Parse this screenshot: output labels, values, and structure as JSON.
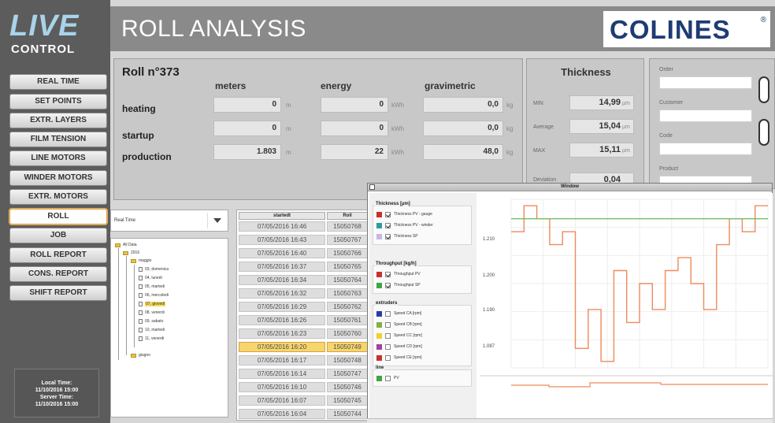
{
  "logo": {
    "live": "LIVE",
    "control": "CONTROL"
  },
  "header": {
    "title": "ROLL ANALYSIS",
    "brand": "COLINES",
    "brand_mark": "®"
  },
  "nav": {
    "items": [
      {
        "label": "REAL TIME"
      },
      {
        "label": "SET POINTS"
      },
      {
        "label": "EXTR. LAYERS"
      },
      {
        "label": "FILM TENSION"
      },
      {
        "label": "LINE MOTORS"
      },
      {
        "label": "WINDER MOTORS"
      },
      {
        "label": "EXTR. MOTORS"
      },
      {
        "label": "ROLL"
      },
      {
        "label": "JOB"
      },
      {
        "label": "ROLL REPORT"
      },
      {
        "label": "CONS. REPORT"
      },
      {
        "label": "SHIFT REPORT"
      }
    ],
    "active": "ROLL"
  },
  "clock": {
    "local_label": "Local Time:",
    "local_value": "11/10/2016 15:00",
    "server_label": "Server Time:",
    "server_value": "11/10/2016 15:00"
  },
  "roll": {
    "title": "Roll n°373",
    "columns": [
      "meters",
      "energy",
      "gravimetric"
    ],
    "rows": [
      {
        "label": "heating",
        "meters": "0",
        "meters_unit": "m",
        "energy": "0",
        "energy_unit": "kWh",
        "grav": "0,0",
        "grav_unit": "kg"
      },
      {
        "label": "startup",
        "meters": "0",
        "meters_unit": "m",
        "energy": "0",
        "energy_unit": "kWh",
        "grav": "0,0",
        "grav_unit": "kg"
      },
      {
        "label": "production",
        "meters": "1.803",
        "meters_unit": "m",
        "energy": "22",
        "energy_unit": "kWh",
        "grav": "48,0",
        "grav_unit": "kg"
      }
    ]
  },
  "thickness": {
    "title": "Thickness",
    "rows": [
      {
        "label": "MIN",
        "value": "14,99",
        "unit": "µm"
      },
      {
        "label": "Average",
        "value": "15,04",
        "unit": "µm"
      },
      {
        "label": "MAX",
        "value": "15,11",
        "unit": "µm"
      }
    ],
    "partial_label": "Deviation",
    "partial_value": "0,04"
  },
  "info": {
    "fields": [
      "Order",
      "Customer",
      "Code",
      "Product"
    ]
  },
  "filter": {
    "value": "Real Time"
  },
  "tree": {
    "root": "All Data",
    "year": "2016",
    "month": "maggio",
    "days": [
      "03, domenica",
      "04, lunedi",
      "05, martedi",
      "06, mercoledi",
      "07, giovedi",
      "08, venerdi",
      "09, sabato",
      "10, martedi",
      "11, venerdi"
    ],
    "selected": "07, giovedi",
    "sibling": "giugno"
  },
  "rolls_list": {
    "headers": [
      "startedt",
      "Roll"
    ],
    "rows": [
      {
        "date": "07/05/2016 16:46",
        "roll": "15050768"
      },
      {
        "date": "07/05/2016 16:43",
        "roll": "15050767"
      },
      {
        "date": "07/05/2016 16:40",
        "roll": "15050766"
      },
      {
        "date": "07/05/2016 16:37",
        "roll": "15050765"
      },
      {
        "date": "07/05/2016 16:34",
        "roll": "15050764"
      },
      {
        "date": "07/05/2016 16:32",
        "roll": "15050763"
      },
      {
        "date": "07/05/2016 16:29",
        "roll": "15050762"
      },
      {
        "date": "07/05/2016 16:26",
        "roll": "15050761"
      },
      {
        "date": "07/05/2016 16:23",
        "roll": "15050760"
      },
      {
        "date": "07/05/2016 16:20",
        "roll": "15050749"
      },
      {
        "date": "07/05/2016 16:17",
        "roll": "15050748"
      },
      {
        "date": "07/05/2016 16:14",
        "roll": "15050747"
      },
      {
        "date": "07/05/2016 16:10",
        "roll": "15050746"
      },
      {
        "date": "07/05/2016 16:07",
        "roll": "15050745"
      },
      {
        "date": "07/05/2016 16:04",
        "roll": "15050744"
      }
    ],
    "selected_index": 9
  },
  "chart_window": {
    "title": "Window",
    "legend_groups": [
      {
        "title": "Thickness [µm]",
        "items": [
          {
            "label": "Thickness PV - gauge",
            "color": "#c9302c",
            "checked": true
          },
          {
            "label": "Thickness PV - winder",
            "color": "#2f9aa0",
            "checked": true
          },
          {
            "label": "Thickness SP",
            "color": "#c7b6e6",
            "checked": true
          }
        ]
      },
      {
        "title": "Throughput [kg/h]",
        "items": [
          {
            "label": "Throughput PV",
            "color": "#c9302c",
            "checked": true
          },
          {
            "label": "Throughput SP",
            "color": "#3da843",
            "checked": true
          }
        ]
      },
      {
        "title": "extruders",
        "items": [
          {
            "label": "Speed CA [rpm]",
            "color": "#2b3d9e",
            "checked": false
          },
          {
            "label": "Speed CB [rpm]",
            "color": "#84b043",
            "checked": false
          },
          {
            "label": "Speed CC [rpm]",
            "color": "#f1cf2f",
            "checked": false
          },
          {
            "label": "Speed CD [rpm]",
            "color": "#a5409a",
            "checked": false
          },
          {
            "label": "Speed CE [rpm]",
            "color": "#c9302c",
            "checked": false
          }
        ]
      },
      {
        "title": "line",
        "items": [
          {
            "label": "PV",
            "color": "#3da843",
            "checked": false
          }
        ]
      }
    ],
    "y_ticks": [
      "1.210",
      "1.200",
      "1.190",
      "1.087"
    ],
    "series_colors": {
      "pv": "#ef8a5c",
      "sp": "#6fc06a"
    }
  },
  "chart_data": {
    "type": "line",
    "title": "",
    "xlabel": "",
    "ylabel": "",
    "ylim": [
      1.085,
      1.215
    ],
    "grid": true,
    "series": [
      {
        "name": "Thickness PV - gauge",
        "values": [
          1.19,
          1.21,
          1.2,
          1.18,
          1.19,
          1.1,
          1.13,
          1.09,
          1.16,
          1.12,
          1.15,
          1.13,
          1.16,
          1.17,
          1.15,
          1.13,
          1.18,
          1.2,
          1.19,
          1.21
        ]
      },
      {
        "name": "Thickness SP",
        "values": [
          1.2,
          1.2,
          1.2,
          1.2,
          1.2,
          1.2,
          1.2,
          1.2,
          1.2,
          1.2,
          1.2,
          1.2,
          1.2,
          1.2,
          1.2,
          1.2,
          1.2,
          1.2,
          1.2,
          1.2
        ]
      }
    ]
  }
}
